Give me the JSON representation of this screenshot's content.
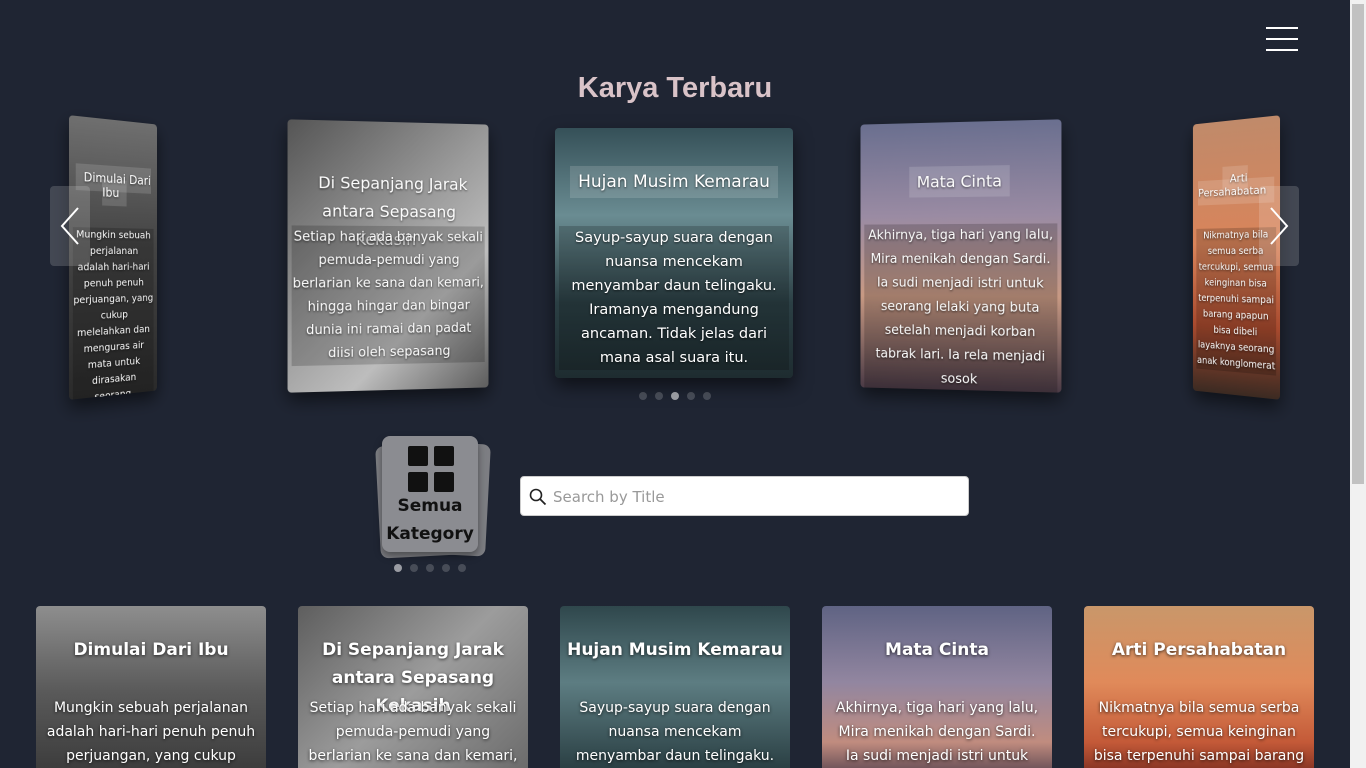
{
  "menu": {
    "icon": "hamburger-menu-icon"
  },
  "page_title": "Karya Terbaru",
  "carousel": {
    "slides": [
      {
        "title": "Dimulai Dari Ibu",
        "desc": "Mungkin sebuah perjalanan adalah hari-hari penuh penuh perjuangan, yang cukup melelahkan dan menguras air mata untuk dirasakan seorang."
      },
      {
        "title": "Di Sepanjang Jarak antara Sepasang Kekasih",
        "desc": "Setiap hari ada banyak sekali pemuda-pemudi yang berlarian ke sana dan kemari, hingga hingar dan bingar dunia ini ramai dan padat diisi oleh sepasang"
      },
      {
        "title": "Hujan Musim Kemarau",
        "desc": "Sayup-sayup suara dengan nuansa mencekam menyambar daun telingaku. Iramanya mengandung ancaman. Tidak jelas dari mana asal suara itu."
      },
      {
        "title": "Mata Cinta",
        "desc": "Akhirnya, tiga hari yang lalu, Mira menikah dengan Sardi. Ia sudi menjadi istri untuk seorang lelaki yang buta setelah menjadi korban tabrak lari. Ia rela menjadi sosok"
      },
      {
        "title": "Arti Persahabatan",
        "desc": "Nikmatnya bila semua serba tercukupi, semua keinginan bisa terpenuhi sampai barang apapun bisa dibeli layaknya seorang anak konglomerat"
      }
    ],
    "prev_icon": "chevron-left-icon",
    "next_icon": "chevron-right-icon",
    "dots_active": 3
  },
  "category": {
    "label": "Semua Kategory",
    "icon": "grid-icon"
  },
  "search": {
    "placeholder": "Search by Title",
    "value": "",
    "icon": "search-icon"
  },
  "cards": [
    {
      "title": "Dimulai Dari Ibu",
      "desc": "Mungkin sebuah perjalanan adalah hari-hari penuh penuh perjuangan, yang cukup"
    },
    {
      "title": "Di Sepanjang Jarak antara Sepasang Kekasih",
      "desc": "Setiap hari ada banyak sekali pemuda-pemudi yang berlarian ke sana dan kemari, hingga"
    },
    {
      "title": "Hujan Musim Kemarau",
      "desc": "Sayup-sayup suara dengan nuansa mencekam menyambar daun telingaku. Iramanya"
    },
    {
      "title": "Mata Cinta",
      "desc": "Akhirnya, tiga hari yang lalu, Mira menikah dengan Sardi. Ia sudi menjadi istri untuk seorang"
    },
    {
      "title": "Arti Persahabatan",
      "desc": "Nikmatnya bila semua serba tercukupi, semua keinginan bisa terpenuhi sampai barang apapun"
    }
  ]
}
